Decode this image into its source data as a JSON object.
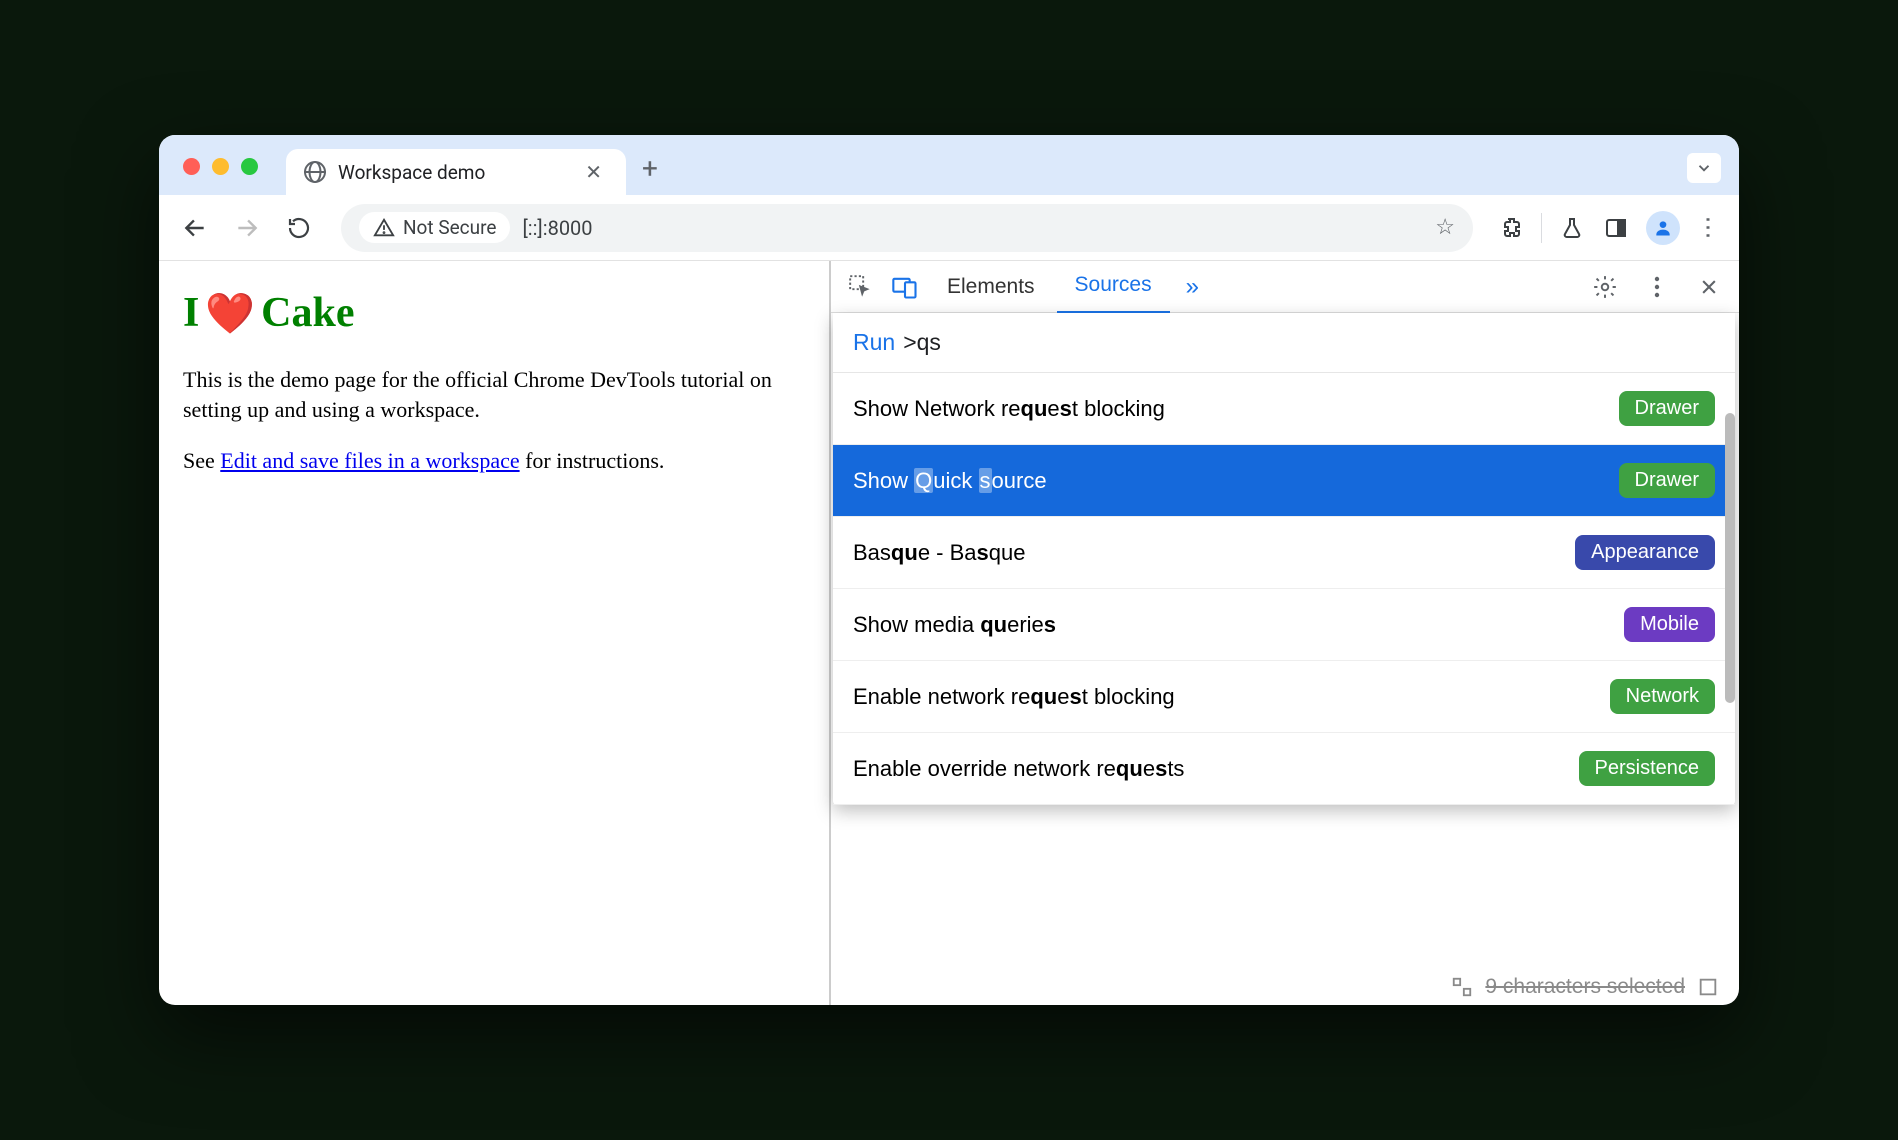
{
  "browser": {
    "tab_title": "Workspace demo",
    "address_label": "Not Secure",
    "url": "[::]:8000"
  },
  "page": {
    "heading_pre": "I",
    "heading_post": "Cake",
    "paragraph": "This is the demo page for the official Chrome DevTools tutorial on setting up and using a workspace.",
    "see_pre": "See ",
    "link_text": "Edit and save files in a workspace",
    "see_post": " for instructions."
  },
  "devtools": {
    "tabs": {
      "elements": "Elements",
      "sources": "Sources"
    },
    "command": {
      "prefix": "Run",
      "gt": ">",
      "query": "qs"
    },
    "items": [
      {
        "pre": "Show Network re",
        "b1": "qu",
        "mid1": "e",
        "b2": "s",
        "mid2": "t blocking",
        "badge": "Drawer",
        "badge_class": "badge-drawer",
        "selected": false
      },
      {
        "pre": "Show ",
        "h1": "Q",
        "mid1": "uick ",
        "h2": "s",
        "mid2": "ource",
        "badge": "Drawer",
        "badge_class": "badge-drawer",
        "selected": true
      },
      {
        "pre": "Bas",
        "b1": "qu",
        "mid1": "e - Ba",
        "b2": "s",
        "mid2": "que",
        "badge": "Appearance",
        "badge_class": "badge-appearance",
        "selected": false
      },
      {
        "pre": "Show media ",
        "b1": "qu",
        "mid1": "erie",
        "b2": "s",
        "mid2": "",
        "badge": "Mobile",
        "badge_class": "badge-mobile",
        "selected": false
      },
      {
        "pre": "Enable network re",
        "b1": "qu",
        "mid1": "e",
        "b2": "s",
        "mid2": "t blocking",
        "badge": "Network",
        "badge_class": "badge-network",
        "selected": false
      },
      {
        "pre": "Enable override network re",
        "b1": "qu",
        "mid1": "e",
        "b2": "s",
        "mid2": "ts",
        "badge": "Persistence",
        "badge_class": "badge-persistence",
        "selected": false
      }
    ],
    "footer_text": "9 characters selected"
  }
}
